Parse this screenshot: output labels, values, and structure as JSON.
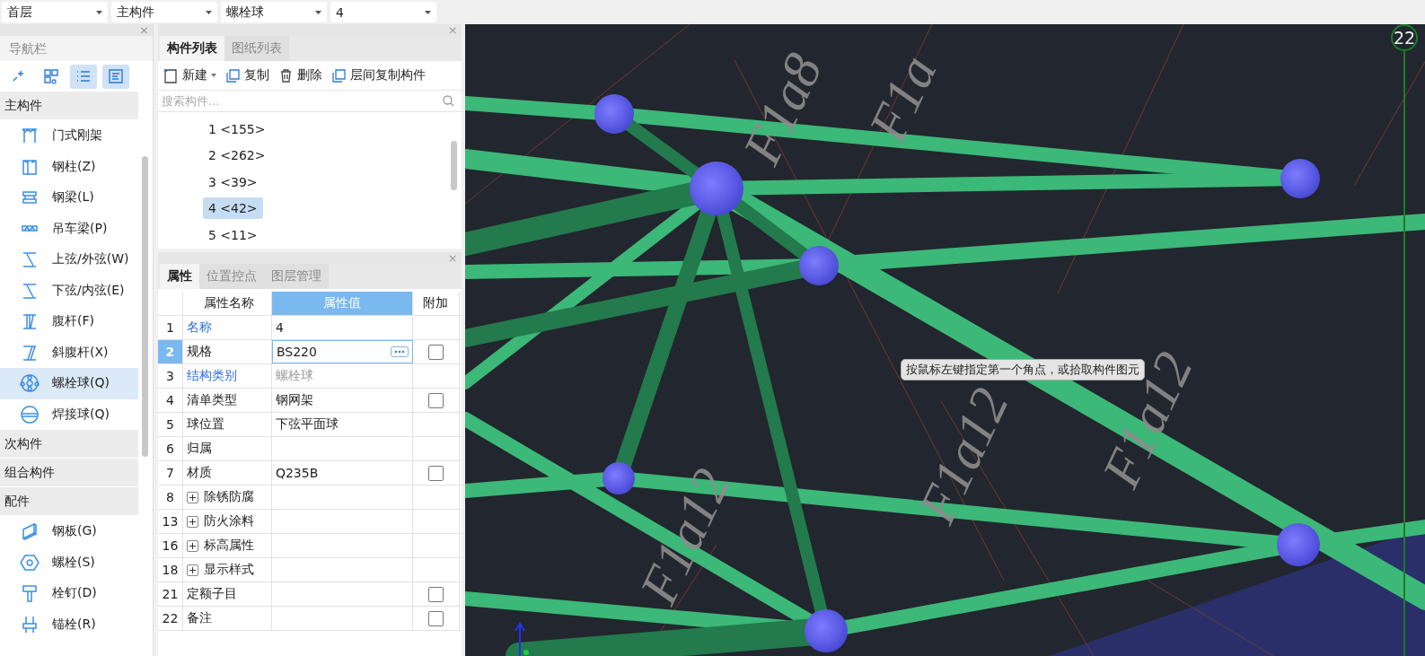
{
  "selectors": [
    {
      "value": "首层"
    },
    {
      "value": "主构件"
    },
    {
      "value": "螺栓球"
    },
    {
      "value": "4"
    }
  ],
  "nav": {
    "close": "×",
    "title": "导航栏",
    "tools": [
      {
        "active": false
      },
      {
        "active": false
      },
      {
        "active": true
      },
      {
        "active": true
      }
    ],
    "groups": [
      {
        "label": "主构件",
        "items": [
          {
            "label": "门式刚架",
            "selected": false
          },
          {
            "label": "钢柱(Z)",
            "selected": false
          },
          {
            "label": "钢梁(L)",
            "selected": false
          },
          {
            "label": "吊车梁(P)",
            "selected": false
          },
          {
            "label": "上弦/外弦(W)",
            "selected": false
          },
          {
            "label": "下弦/内弦(E)",
            "selected": false
          },
          {
            "label": "腹杆(F)",
            "selected": false
          },
          {
            "label": "斜腹杆(X)",
            "selected": false
          },
          {
            "label": "螺栓球(Q)",
            "selected": true
          },
          {
            "label": "焊接球(Q)",
            "selected": false
          }
        ]
      },
      {
        "label": "次构件"
      },
      {
        "label": "组合构件"
      },
      {
        "label": "配件",
        "items": [
          {
            "label": "钢板(G)",
            "selected": false
          },
          {
            "label": "螺栓(S)",
            "selected": false
          },
          {
            "label": "栓钉(D)",
            "selected": false
          },
          {
            "label": "锚栓(R)",
            "selected": false
          }
        ]
      }
    ]
  },
  "component_panel": {
    "close": "×",
    "tabs": [
      {
        "label": "构件列表",
        "selected": true
      },
      {
        "label": "图纸列表",
        "selected": false
      }
    ],
    "toolbar": [
      {
        "label": "新建",
        "kind": "split"
      },
      {
        "label": "复制",
        "kind": "action"
      },
      {
        "label": "删除",
        "kind": "action"
      },
      {
        "label": "层间复制构件",
        "kind": "action"
      }
    ],
    "search": {
      "placeholder": "搜索构件..."
    },
    "items": [
      {
        "label": "1 <155>",
        "selected": false
      },
      {
        "label": "2 <262>",
        "selected": false
      },
      {
        "label": "3 <39>",
        "selected": false
      },
      {
        "label": "4 <42>",
        "selected": true
      },
      {
        "label": "5 <11>",
        "selected": false
      }
    ]
  },
  "property_panel": {
    "close": "×",
    "tabs": [
      {
        "label": "属性",
        "selected": true
      },
      {
        "label": "位置控点",
        "selected": false
      },
      {
        "label": "图层管理",
        "selected": false
      }
    ],
    "columns": [
      {
        "label": "属性名称",
        "selected": false
      },
      {
        "label": "属性值",
        "selected": true
      },
      {
        "label": "附加",
        "selected": false
      }
    ],
    "rows": [
      {
        "kind": "field",
        "num": "1",
        "name": "名称",
        "value": "4",
        "public": true,
        "disabled": false,
        "selected": false
      },
      {
        "kind": "field",
        "num": "2",
        "name": "规格",
        "value": "BS220",
        "public": false,
        "disabled": false,
        "attach": {
          "checked": false
        },
        "selected": true
      },
      {
        "kind": "field",
        "num": "3",
        "name": "结构类别",
        "value": "螺栓球",
        "public": true,
        "disabled": true,
        "selected": false
      },
      {
        "kind": "field",
        "num": "4",
        "name": "清单类型",
        "value": "钢网架",
        "public": false,
        "disabled": false,
        "attach": {
          "checked": false
        },
        "selected": false
      },
      {
        "kind": "field",
        "num": "5",
        "name": "球位置",
        "value": "下弦平面球",
        "public": false,
        "disabled": false,
        "selected": false
      },
      {
        "kind": "field",
        "num": "6",
        "name": "归属",
        "public": false,
        "selected": false
      },
      {
        "kind": "field",
        "num": "7",
        "name": "材质",
        "value": "Q235B",
        "public": false,
        "disabled": false,
        "attach": {
          "checked": false
        },
        "selected": false
      },
      {
        "kind": "group",
        "num": "8",
        "name": "除锈防腐",
        "public": false,
        "selected": false
      },
      {
        "kind": "group",
        "num": "13",
        "name": "防火涂料",
        "public": false,
        "selected": false
      },
      {
        "kind": "group",
        "num": "16",
        "name": "标高属性",
        "public": false,
        "selected": false
      },
      {
        "kind": "group",
        "num": "18",
        "name": "显示样式",
        "public": false,
        "selected": false
      },
      {
        "kind": "field",
        "num": "21",
        "name": "定额子目",
        "public": false,
        "attach": {
          "checked": false
        },
        "selected": false
      },
      {
        "kind": "field",
        "num": "22",
        "name": "备注",
        "public": false,
        "attach": {
          "checked": false
        },
        "selected": false
      }
    ]
  },
  "viewport": {
    "annotations": [
      "F1a8",
      "F1a",
      "F1a12",
      "F1a12",
      "F1a12"
    ],
    "axis_label": "22",
    "tooltip": "按鼠标左键指定第一个角点，或拾取构件图元"
  }
}
